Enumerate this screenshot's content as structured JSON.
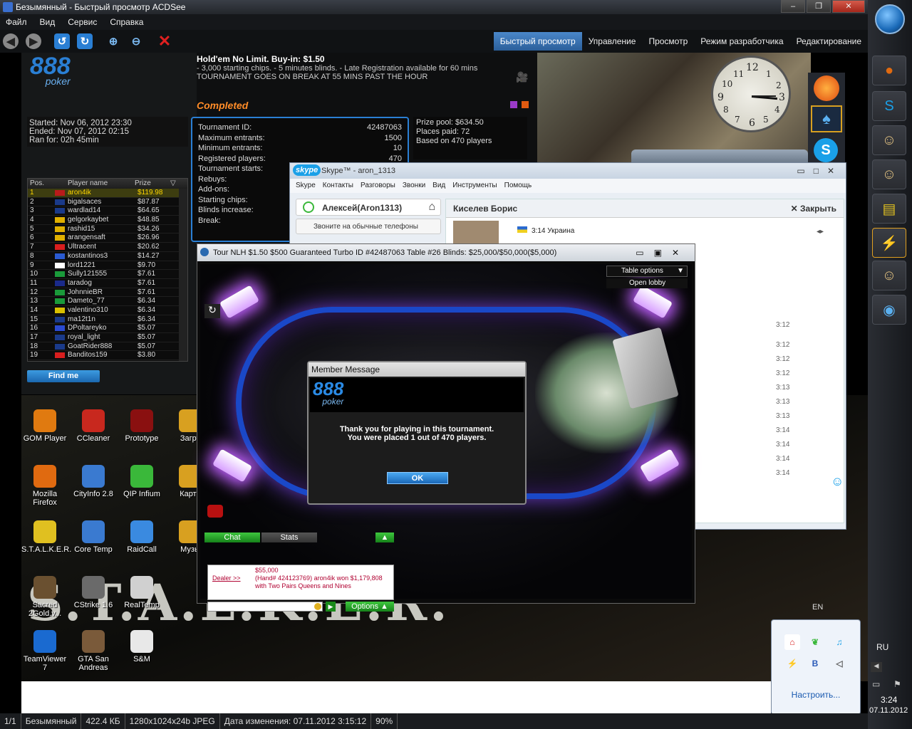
{
  "window": {
    "title": "Безымянный - Быстрый просмотр ACDSee",
    "min": "–",
    "max": "❐",
    "close": "✕"
  },
  "menu": [
    "Файл",
    "Вид",
    "Сервис",
    "Справка"
  ],
  "modes": [
    "Быстрый просмотр",
    "Управление",
    "Просмотр",
    "Режим разработчика",
    "Редактирование"
  ],
  "lobby": {
    "logo": "888",
    "logo_sub": "poker",
    "started": "Started: Nov 06, 2012 23:30",
    "ended": "Ended: Nov 07, 2012 02:15",
    "ran": "Ran for: 02h 45min",
    "headers": [
      "Pos.",
      "Player name",
      "Prize"
    ],
    "players": [
      {
        "pos": "1",
        "name": "aron4ik",
        "prize": "$119.98",
        "flag": "#b81b1b"
      },
      {
        "pos": "2",
        "name": "bigalsaces",
        "prize": "$87.87",
        "flag": "#1a3a8a"
      },
      {
        "pos": "3",
        "name": "wardlad14",
        "prize": "$64.65",
        "flag": "#1a3a8a"
      },
      {
        "pos": "4",
        "name": "gelgorkaybet",
        "prize": "$48.85",
        "flag": "#e0b000"
      },
      {
        "pos": "5",
        "name": "rashid15",
        "prize": "$34.26",
        "flag": "#e0b000"
      },
      {
        "pos": "6",
        "name": "arangensaft",
        "prize": "$26.96",
        "flag": "#e0b000"
      },
      {
        "pos": "7",
        "name": "Ultracent",
        "prize": "$20.62",
        "flag": "#d81e1e"
      },
      {
        "pos": "8",
        "name": "kostantinos3",
        "prize": "$14.27",
        "flag": "#2a5ad0"
      },
      {
        "pos": "9",
        "name": "lord1221",
        "prize": "$9.70",
        "flag": "#ffffff"
      },
      {
        "pos": "10",
        "name": "Sully121555",
        "prize": "$7.61",
        "flag": "#1a9a3a"
      },
      {
        "pos": "11",
        "name": "taradog",
        "prize": "$7.61",
        "flag": "#1a2a8a"
      },
      {
        "pos": "12",
        "name": "JohnnieBR",
        "prize": "$7.61",
        "flag": "#1a9a3a"
      },
      {
        "pos": "13",
        "name": "Dameto_77",
        "prize": "$6.34",
        "flag": "#1a9a3a"
      },
      {
        "pos": "14",
        "name": "valentino310",
        "prize": "$6.34",
        "flag": "#d8c000"
      },
      {
        "pos": "15",
        "name": "ma12t1n",
        "prize": "$6.34",
        "flag": "#1a3a8a"
      },
      {
        "pos": "16",
        "name": "DPoltareyko",
        "prize": "$5.07",
        "flag": "#2a4ad0"
      },
      {
        "pos": "17",
        "name": "royal_light",
        "prize": "$5.07",
        "flag": "#1a3a8a"
      },
      {
        "pos": "18",
        "name": "GoatRider888",
        "prize": "$5.07",
        "flag": "#1a3a8a"
      },
      {
        "pos": "19",
        "name": "Banditos159",
        "prize": "$3.80",
        "flag": "#d81e1e"
      }
    ],
    "find_me": "Find me"
  },
  "tournament": {
    "title": "Hold'em No Limit. Buy-in: $1.50",
    "line1": "- 3,000 starting chips.  - 5 minutes blinds.  - Late Registration available for 60 mins",
    "line2": "TOURNAMENT GOES ON BREAK AT 55 MINS PAST THE HOUR",
    "status": "Completed",
    "rows": [
      {
        "label": "Tournament ID:",
        "value": "42487063"
      },
      {
        "label": "Maximum entrants:",
        "value": "1500"
      },
      {
        "label": "Minimum entrants:",
        "value": "10"
      },
      {
        "label": "Registered players:",
        "value": "470"
      },
      {
        "label": "Tournament starts:",
        "value": ""
      },
      {
        "label": "Rebuys:",
        "value": ""
      },
      {
        "label": "Add-ons:",
        "value": ""
      },
      {
        "label": "Starting chips:",
        "value": ""
      },
      {
        "label": "Blinds increase:",
        "value": ""
      },
      {
        "label": "Break:",
        "value": ""
      }
    ],
    "prize_pool": "Prize pool: $634.50",
    "places_paid": "Places paid: 72",
    "based_on": "Based on 470 players"
  },
  "clock": {
    "n12": "12",
    "n1": "1",
    "n2": "2",
    "n3": "3",
    "n4": "4",
    "n5": "5",
    "n6": "6",
    "n7": "7",
    "n8": "8",
    "n9": "9",
    "n10": "10",
    "n11": "11"
  },
  "skype": {
    "title": "Skype™ - aron_1313",
    "logo": "skype",
    "menu": [
      "Skype",
      "Контакты",
      "Разговоры",
      "Звонки",
      "Вид",
      "Инструменты",
      "Помощь"
    ],
    "self_name": "Алексей(Aron1313)",
    "call_phones": "Звоните на обычные телефоны",
    "contact": "Киселев Борис",
    "close": "Закрыть",
    "local_time": "3:14 Украина",
    "times": [
      "3:12",
      "3:12",
      "3:12",
      "3:12",
      "3:13",
      "3:13",
      "3:13",
      "3:14",
      "3:14",
      "3:14",
      "3:14"
    ]
  },
  "table": {
    "title": "Tour NLH $1.50 $500 Guaranteed Turbo  ID #42487063 Table #26 Blinds: $25,000/$50,000($5,000)",
    "table_options": "Table options",
    "open_lobby": "Open lobby",
    "chat_tab": "Chat",
    "stats_tab": "Stats",
    "chat_dealer": "Dealer >>",
    "chat_text": "$55,000",
    "chat_text2": "(Hand# 424123769) aron4ik won $1,179,808 with Two Pairs Queens and Nines",
    "options": "Options"
  },
  "dialog": {
    "title": "Member Message",
    "logo": "888",
    "logo_sub": "poker",
    "line1": "Thank you for playing in this tournament.",
    "line2": "You were placed 1 out of 470 players.",
    "ok": "OK"
  },
  "desktop": {
    "icons": [
      {
        "label": "GOM Player",
        "color": "#e07a10"
      },
      {
        "label": "CCleaner",
        "color": "#c8281e"
      },
      {
        "label": "Prototype",
        "color": "#8a1010"
      },
      {
        "label": "Загру",
        "color": "#d8a020"
      },
      {
        "label": "Mozilla Firefox",
        "color": "#e06a10"
      },
      {
        "label": "CityInfo 2.8",
        "color": "#3a7ad0"
      },
      {
        "label": "QIP Infium",
        "color": "#3ab83a"
      },
      {
        "label": "Карти",
        "color": "#d8a020"
      },
      {
        "label": "S.T.A.L.K.E.R.",
        "color": "#e0c020"
      },
      {
        "label": "Core Temp",
        "color": "#3a7ad0"
      },
      {
        "label": "RaidCall",
        "color": "#3a8ae0"
      },
      {
        "label": "Музы",
        "color": "#d8a020"
      },
      {
        "label": "Sacred 2Gold.v...",
        "color": "#6a5030"
      },
      {
        "label": "CStrike 1.6",
        "color": "#6a6a6a"
      },
      {
        "label": "RealTemp",
        "color": "#d0d0d0"
      },
      {
        "label": "TeamViewer 7",
        "color": "#1a6ad0"
      },
      {
        "label": "GTA San Andreas",
        "color": "#7a5a3a"
      },
      {
        "label": "S&M",
        "color": "#e8e8e8"
      }
    ],
    "wallpaper": "S.T.A.L.K.E.R.",
    "lang_en": "EN"
  },
  "tray": {
    "configure": "Настроить...",
    "lang": "RU",
    "time": "3:24",
    "date": "07.11.2012"
  },
  "statusbar": [
    "1/1",
    "Безымянный",
    "422.4 КБ",
    "1280x1024x24b JPEG",
    "Дата изменения: 07.11.2012 3:15:12",
    "90%"
  ]
}
